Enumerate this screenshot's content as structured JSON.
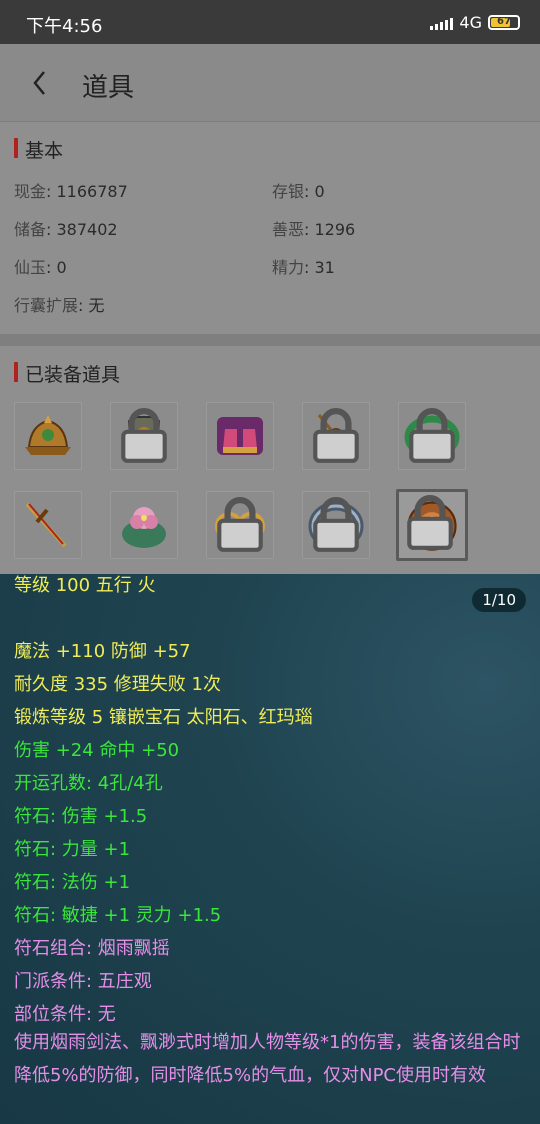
{
  "status": {
    "time": "下午4:56",
    "network": "4G",
    "battery": "67"
  },
  "header": {
    "title": "道具"
  },
  "basic": {
    "title": "基本",
    "stats": [
      {
        "label": "现金",
        "value": "1166787"
      },
      {
        "label": "存银",
        "value": "0"
      },
      {
        "label": "储备",
        "value": "387402"
      },
      {
        "label": "善恶",
        "value": "1296"
      },
      {
        "label": "仙玉",
        "value": "0"
      },
      {
        "label": "精力",
        "value": "31"
      },
      {
        "label": "行囊扩展",
        "value": "无"
      }
    ]
  },
  "equipped": {
    "title": "已装备道具",
    "items": [
      {
        "icon": "helmet-icon",
        "locked": false
      },
      {
        "icon": "armor-icon",
        "locked": true
      },
      {
        "icon": "boots-icon",
        "locked": false
      },
      {
        "icon": "pendant-icon",
        "locked": true
      },
      {
        "icon": "belt-icon",
        "locked": true
      },
      {
        "icon": "sword-icon",
        "locked": false
      },
      {
        "icon": "jade-flower-icon",
        "locked": false
      },
      {
        "icon": "earrings-icon",
        "locked": true
      },
      {
        "icon": "ring-icon",
        "locked": true
      },
      {
        "icon": "medallion-icon",
        "locked": true,
        "selected": true
      }
    ]
  },
  "tooltip": {
    "pager": "1/10",
    "lines": {
      "level": "等级 100 五行 火",
      "magic": "魔法 +110 防御 +57",
      "durability": "耐久度 335 修理失败 1次",
      "forge": "锻炼等级 5 镶嵌宝石 太阳石、红玛瑙",
      "damage": "伤害 +24 命中 +50",
      "slots": "开运孔数: 4孔/4孔",
      "rune1": "符石: 伤害 +1.5",
      "rune2": "符石: 力量 +1",
      "rune3": "符石: 法伤 +1",
      "rune4": "符石: 敏捷 +1 灵力 +1.5",
      "combo": "符石组合: 烟雨飘摇",
      "school": "门派条件: 五庄观",
      "position": "部位条件: 无",
      "description": "使用烟雨剑法、飘渺式时增加人物等级*1的伤害，装备该组合时降低5%的防御，同时降低5%的气血，仅对NPC使用时有效"
    }
  },
  "colors": {
    "yellow": "#f0ec56",
    "green": "#3ae63a",
    "pink": "#e58ee8",
    "accent": "#b32020"
  }
}
